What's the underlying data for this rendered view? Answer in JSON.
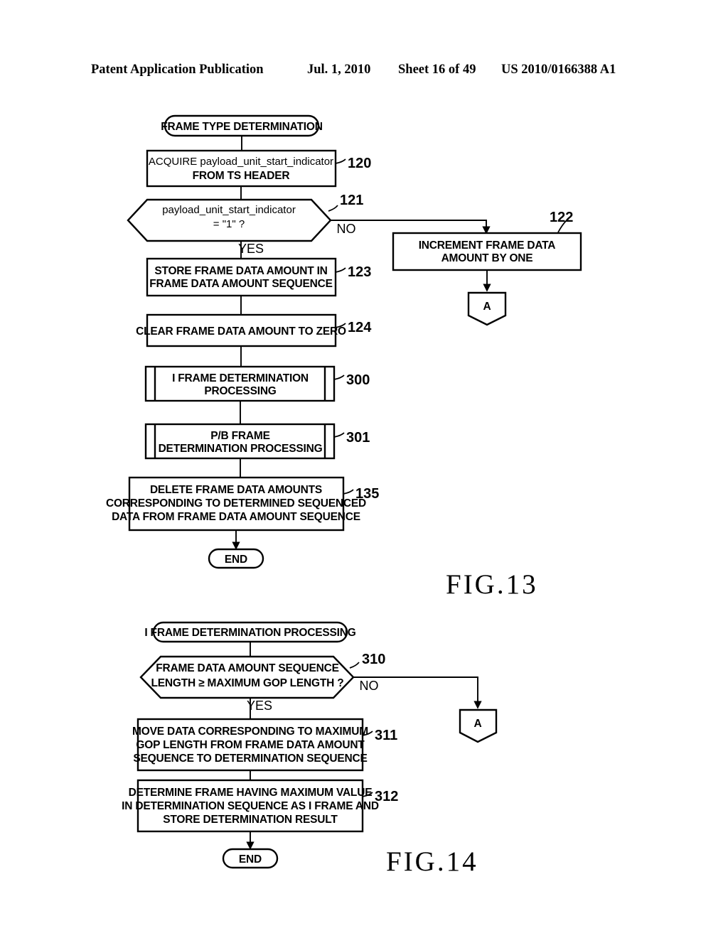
{
  "header": {
    "publication": "Patent Application Publication",
    "date": "Jul. 1, 2010",
    "sheet": "Sheet 16 of 49",
    "number": "US 2010/0166388 A1"
  },
  "figures": [
    {
      "caption": "FIG.13",
      "nodes": {
        "start": {
          "label": "FRAME TYPE DETERMINATION"
        },
        "s120": {
          "ref": "120",
          "lines": [
            "ACQUIRE payload_unit_start_indicator",
            "FROM TS HEADER"
          ]
        },
        "d121": {
          "ref": "121",
          "lines": [
            "payload_unit_start_indicator",
            "= \"1\" ?"
          ],
          "yes": "YES",
          "no": "NO"
        },
        "s122": {
          "ref": "122",
          "lines": [
            "INCREMENT FRAME DATA",
            "AMOUNT BY ONE"
          ]
        },
        "connA": {
          "label": "A"
        },
        "s123": {
          "ref": "123",
          "lines": [
            "STORE FRAME DATA AMOUNT IN",
            "FRAME DATA AMOUNT SEQUENCE"
          ]
        },
        "s124": {
          "ref": "124",
          "lines": [
            "CLEAR FRAME DATA AMOUNT TO ZERO"
          ]
        },
        "s300": {
          "ref": "300",
          "lines": [
            "I FRAME DETERMINATION",
            "PROCESSING"
          ]
        },
        "s301": {
          "ref": "301",
          "lines": [
            "P/B FRAME",
            "DETERMINATION PROCESSING"
          ]
        },
        "s135": {
          "ref": "135",
          "lines": [
            "DELETE FRAME DATA AMOUNTS",
            "CORRESPONDING TO DETERMINED SEQUENCED",
            "DATA FROM FRAME DATA AMOUNT SEQUENCE"
          ]
        },
        "end": {
          "label": "END"
        }
      }
    },
    {
      "caption": "FIG.14",
      "nodes": {
        "start": {
          "label": "I FRAME DETERMINATION PROCESSING"
        },
        "d310": {
          "ref": "310",
          "lines": [
            "FRAME DATA AMOUNT SEQUENCE",
            "LENGTH ≥ MAXIMUM GOP LENGTH ?"
          ],
          "yes": "YES",
          "no": "NO"
        },
        "connA": {
          "label": "A"
        },
        "s311": {
          "ref": "311",
          "lines": [
            "MOVE DATA CORRESPONDING TO MAXIMUM",
            "GOP LENGTH FROM FRAME DATA AMOUNT",
            "SEQUENCE TO DETERMINATION SEQUENCE"
          ]
        },
        "s312": {
          "ref": "312",
          "lines": [
            "DETERMINE FRAME HAVING MAXIMUM VALUE",
            "IN DETERMINATION SEQUENCE AS I FRAME AND",
            "STORE DETERMINATION RESULT"
          ]
        },
        "end": {
          "label": "END"
        }
      }
    }
  ],
  "colors": {
    "ink": "#000000",
    "paper": "#ffffff"
  }
}
